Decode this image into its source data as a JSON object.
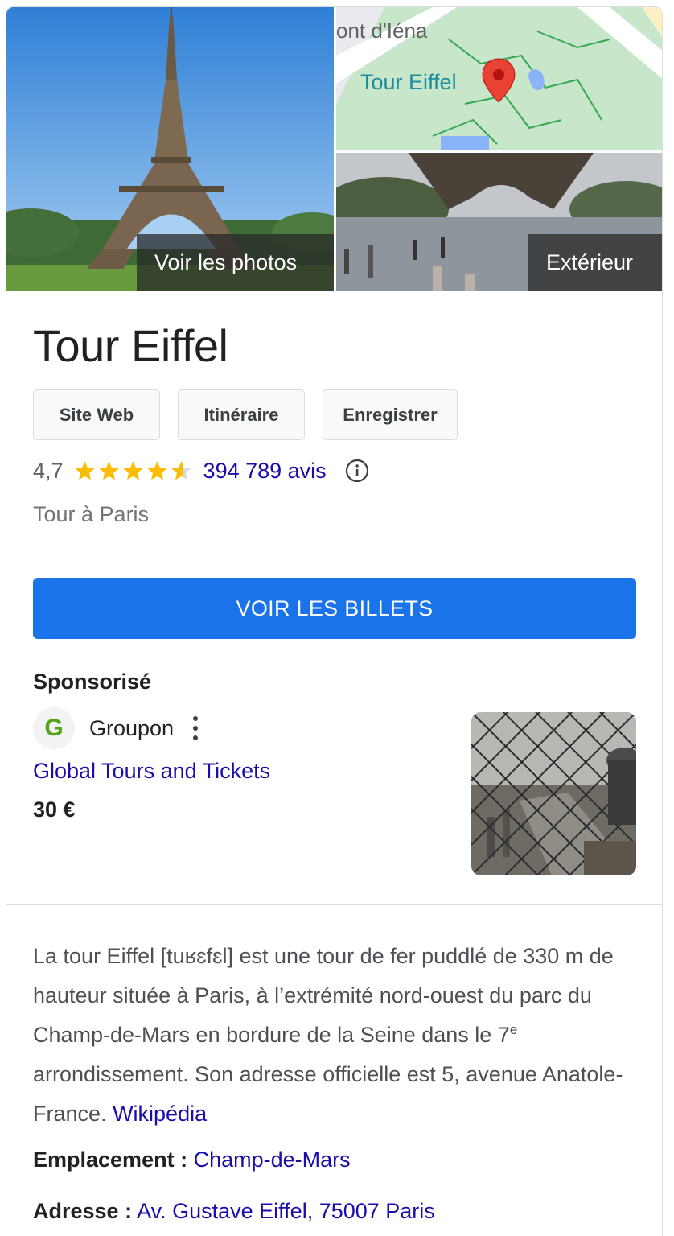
{
  "colors": {
    "link": "#1a0dab",
    "primary_button": "#1a73e8",
    "star": "#fbbc04",
    "border": "#dadce0"
  },
  "gallery": {
    "main_photo_label": "Voir les photos",
    "map_label": "Tour Eiffel",
    "map_street_label": "ont d'Iéna",
    "exterior_label": "Extérieur"
  },
  "place": {
    "title": "Tour Eiffel",
    "actions": {
      "website": "Site Web",
      "directions": "Itinéraire",
      "save": "Enregistrer"
    },
    "rating": "4,7",
    "stars": 4.7,
    "reviews": "394 789 avis",
    "category": "Tour à Paris",
    "tickets_button": "VOIR LES BILLETS"
  },
  "sponsored": {
    "label": "Sponsorisé",
    "advertiser": "Groupon",
    "advertiser_logo_letter": "G",
    "offer_title": "Global Tours and Tickets",
    "offer_price": "30 €"
  },
  "description": {
    "text": "La tour Eiffel [tuʁɛfɛl] est une tour de fer puddlé de 330 m de hauteur située à Paris, à l’extrémité nord-ouest du parc du Champ-de-Mars en bordure de la Seine dans le 7",
    "superscript": "e",
    "text_after": " arrondissement. Son adresse officielle est 5, avenue Anatole-France.",
    "source": "Wikipédia"
  },
  "facts": {
    "location_label": "Emplacement :",
    "location_value": "Champ-de-Mars",
    "address_label": "Adresse :",
    "address_value": "Av. Gustave Eiffel, 75007 Paris"
  }
}
